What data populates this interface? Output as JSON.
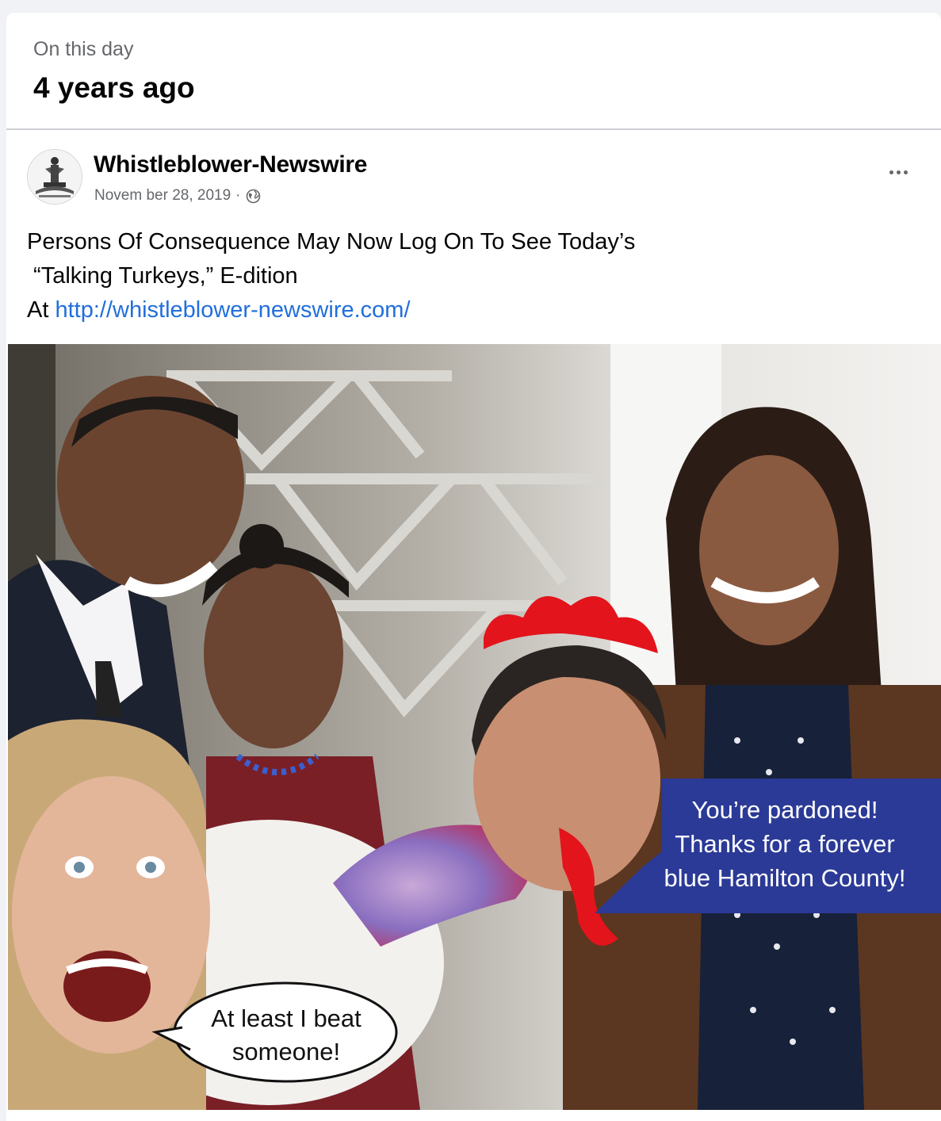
{
  "memory": {
    "kicker": "On this day",
    "title": "4 years ago"
  },
  "post": {
    "author": "Whistleblower-Newswire",
    "date": "Novem ber 28, 2019",
    "separator": "·",
    "privacy_icon": "globe-icon",
    "more_icon": "more-options-icon",
    "text_lines": [
      "Persons Of Consequence May Now Log On To See Today’s",
      " “Talking Turkeys,” E-dition",
      "At "
    ],
    "link": "http://whistleblower-newswire.com/"
  },
  "photo": {
    "blue_bubble": {
      "lines": [
        "You’re pardoned!",
        "Thanks for a forever",
        "blue Hamilton County!"
      ],
      "color": "#2b3a96"
    },
    "white_bubble": {
      "lines": [
        "At least I beat",
        "someone!"
      ]
    }
  },
  "colors": {
    "link": "#216fdb",
    "muted": "#65676b",
    "comb": "#e3141c"
  }
}
